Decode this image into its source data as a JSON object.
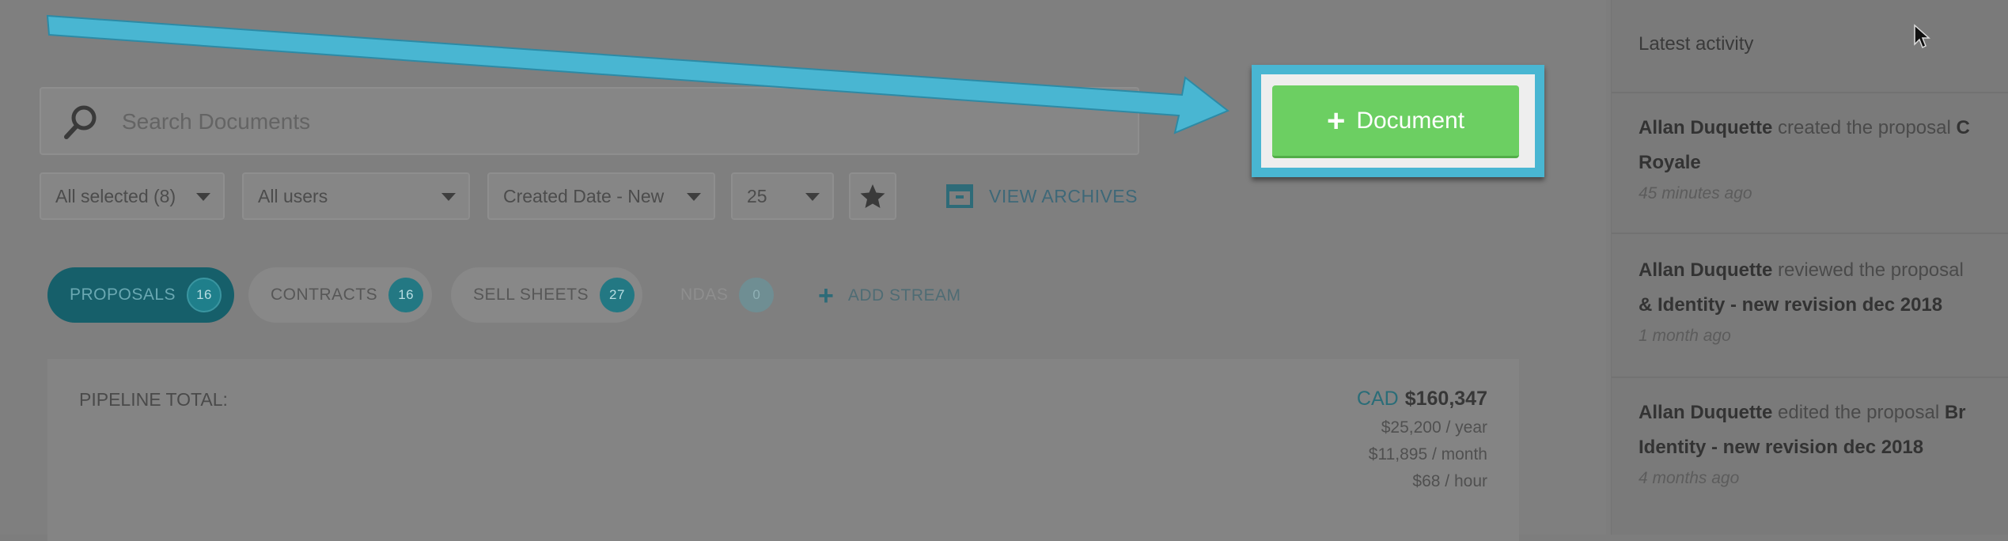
{
  "search": {
    "placeholder": "Search Documents"
  },
  "filters": {
    "status": "All selected (8)",
    "users": "All users",
    "sort": "Created Date - New",
    "per_page": "25",
    "archives_label": "VIEW ARCHIVES"
  },
  "streams": [
    {
      "label": "PROPOSALS",
      "count": "16"
    },
    {
      "label": "CONTRACTS",
      "count": "16"
    },
    {
      "label": "SELL SHEETS",
      "count": "27"
    },
    {
      "label": "NDAS",
      "count": "0"
    }
  ],
  "add_stream_label": "ADD STREAM",
  "pipeline": {
    "label": "PIPELINE TOTAL:",
    "currency": "CAD",
    "total": "$160,347",
    "per_year": "$25,200 / year",
    "per_month": "$11,895 / month",
    "per_hour": "$68 / hour"
  },
  "document_button": {
    "plus": "+",
    "label": "Document"
  },
  "sidebar": {
    "title": "Latest activity",
    "activities": [
      {
        "user": "Allan Duquette",
        "action": " created the proposal ",
        "line1_obj": "C",
        "line2": "Royale",
        "time": "45 minutes ago"
      },
      {
        "user": "Allan Duquette",
        "action": " reviewed the proposal",
        "line1_obj": "",
        "line2": "& Identity - new revision dec 2018",
        "time": "1 month ago"
      },
      {
        "user": "Allan Duquette",
        "action": " edited the proposal ",
        "line1_obj": "Br",
        "line2": "Identity - new revision dec 2018",
        "time": "4 months ago"
      }
    ]
  },
  "colors": {
    "highlight": "#49b6d2",
    "button_green": "#6ccf62",
    "teal": "#1f7f8b"
  }
}
